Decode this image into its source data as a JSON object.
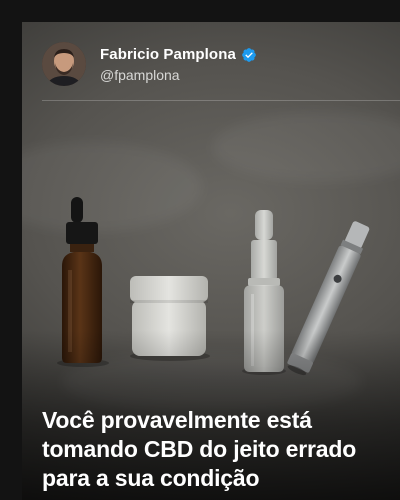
{
  "post": {
    "author": {
      "name": "Fabricio Pamplona",
      "handle": "@fpamplona",
      "verified_icon": "verified-check-icon",
      "verified_color": "#1d9bf0"
    },
    "image": {
      "items": [
        "dropper-bottle",
        "cream-jar",
        "spray-bottle",
        "vape-pen"
      ]
    },
    "headline": {
      "line1": "Você provavelmente está",
      "line2": "tomando CBD do jeito errado",
      "line3": "para a sua condição"
    }
  }
}
